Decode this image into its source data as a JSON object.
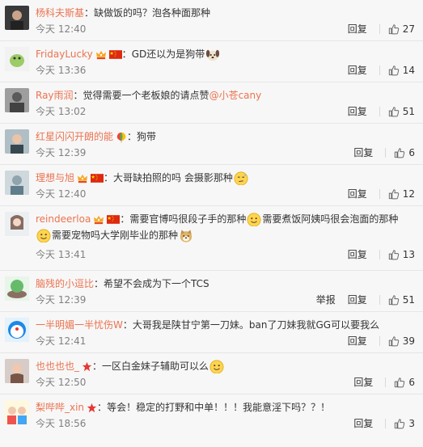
{
  "comments": [
    {
      "username": "杨科夫斯基",
      "badges": [],
      "separator": "：",
      "text": "缺做饭的吗？泡各种面那种",
      "time": "今天 12:40",
      "actions": [
        "回复"
      ],
      "likes": "27"
    },
    {
      "username": "FridayLucky",
      "badges": [
        "vip-icon",
        "china-flag-icon"
      ],
      "separator": "：",
      "text": "GD还以为是狗带",
      "emoji_after": "dog-emoji-icon",
      "time": "今天 13:36",
      "actions": [
        "回复"
      ],
      "likes": "14"
    },
    {
      "username": "Ray雨润",
      "badges": [],
      "separator": "：",
      "text": "觉得需要一个老板娘的请点赞",
      "mention": "@小苍cany",
      "time": "今天 13:02",
      "actions": [
        "回复"
      ],
      "likes": "51"
    },
    {
      "username": "红星闪闪开朗的能",
      "badges": [
        "rainbow-balloon-icon"
      ],
      "separator": "：",
      "text": "狗带",
      "time": "今天 12:39",
      "actions": [
        "回复"
      ],
      "likes": "6"
    },
    {
      "username": "理想与旭",
      "badges": [
        "vip-icon",
        "china-flag-icon"
      ],
      "separator": "：",
      "text": "大哥缺拍照的吗 会摄影那种",
      "emoji_after": "sweat-face-icon",
      "time": "今天 12:40",
      "actions": [
        "回复"
      ],
      "likes": "12"
    },
    {
      "username": "reindeerloa",
      "badges": [
        "vip-icon",
        "china-flag-icon"
      ],
      "separator": "：",
      "text": "需要官博吗很段子手的那种",
      "text2": "需要煮饭阿姨吗很会泡面的那种",
      "text3": "需要宠物吗大学刚毕业的那种",
      "time": "今天 13:41",
      "actions": [
        "回复"
      ],
      "likes": "13"
    },
    {
      "username": "脑残的小逗比",
      "badges": [],
      "separator": "：",
      "text": "希望不会成为下一个TCS",
      "time": "今天 12:39",
      "actions": [
        "举报",
        "回复"
      ],
      "likes": "51"
    },
    {
      "username": "一半明媚一半忧伤W",
      "badges": [],
      "separator": "：",
      "text": "大哥我是陕甘宁第一刀妹。ban了刀妹我就GG可以要我么",
      "time": "今天 12:41",
      "actions": [
        "回复"
      ],
      "likes": "39"
    },
    {
      "username": "也也也也_",
      "badges": [
        "red-star-icon"
      ],
      "separator": "：",
      "text": "一区白金妹子辅助可以么",
      "emoji_after": "smile-face-icon",
      "time": "今天 12:50",
      "actions": [
        "回复"
      ],
      "likes": "6"
    },
    {
      "username": "梨哔哔_xin",
      "badges": [
        "red-star-icon"
      ],
      "separator": "：",
      "text": "等会！稳定的打野和中单！！！我能意淫下吗？？！",
      "time": "今天 18:56",
      "actions": [
        "回复"
      ],
      "likes": "3"
    }
  ],
  "colors": {
    "username": "#eb7350",
    "time": "#808080",
    "text": "#333333"
  }
}
